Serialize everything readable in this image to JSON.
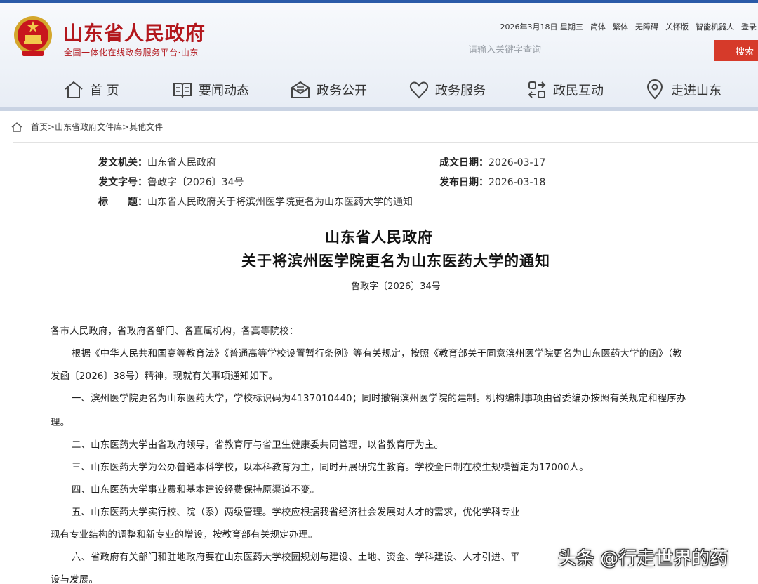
{
  "header": {
    "site_title": "山东省人民政府",
    "site_subtitle": "全国一体化在线政务服务平台·山东",
    "top_links": {
      "date": "2026年3月18日 星期三",
      "simplified": "简体",
      "traditional": "繁体",
      "accessible": "无障碍",
      "elderly": "关怀版",
      "robot": "智能机器人",
      "login": "登录"
    },
    "search": {
      "placeholder": "请输入关键字查询",
      "button": "搜索"
    },
    "nav": [
      {
        "label": "首 页",
        "icon": "home-icon"
      },
      {
        "label": "要闻动态",
        "icon": "book-icon"
      },
      {
        "label": "政务公开",
        "icon": "mail-icon"
      },
      {
        "label": "政务服务",
        "icon": "heart-icon"
      },
      {
        "label": "政民互动",
        "icon": "interaction-icon"
      },
      {
        "label": "走进山东",
        "icon": "location-icon"
      }
    ],
    "colors": {
      "brand_red": "#b3171d",
      "accent_blue": "#2a5aa8",
      "search_red": "#d63a2a"
    }
  },
  "breadcrumb": {
    "home": "首页",
    "library": "山东省政府文件库",
    "current": "其他文件",
    "separator": ">"
  },
  "meta": {
    "issuer_label": "发文机关：",
    "issuer": "山东省人民政府",
    "number_label": "发文字号：",
    "number": "鲁政字〔2026〕34号",
    "title_label": "标　　题：",
    "title": "山东省人民政府关于将滨州医学院更名为山东医药大学的通知",
    "written_label": "成文日期：",
    "written": "2026-03-17",
    "published_label": "发布日期：",
    "published": "2026-03-18"
  },
  "document": {
    "title_line1": "山东省人民政府",
    "title_line2": "关于将滨州医学院更名为山东医药大学的通知",
    "number": "鲁政字〔2026〕34号",
    "paragraphs": [
      "各市人民政府，省政府各部门、各直属机构，各高等院校：",
      "根据《中华人民共和国高等教育法》《普通高等学校设置暂行条例》等有关规定，按照《教育部关于同意滨州医学院更名为山东医药大学的函》（教",
      "发函〔2026〕38号）精神，现就有关事项通知如下。",
      "一、滨州医学院更名为山东医药大学，学校标识码为4137010440；同时撤销滨州医学院的建制。机构编制事项由省委编办按照有关规定和程序办",
      "理。",
      "二、山东医药大学由省政府领导，省教育厅与省卫生健康委共同管理，以省教育厅为主。",
      "三、山东医药大学为公办普通本科学校，以本科教育为主，同时开展研究生教育。学校全日制在校生规模暂定为17000人。",
      "四、山东医药大学事业费和基本建设经费保持原渠道不变。",
      "五、山东医药大学实行校、院（系）两级管理。学校应根据我省经济社会发展对人才的需求，优化学科专业",
      "现有专业结构的调整和新专业的增设，按教育部有关规定办理。",
      "六、省政府有关部门和驻地政府要在山东医药大学校园规划与建设、土地、资金、学科建设、人才引进、平",
      "设与发展。"
    ]
  },
  "watermark": "头条 @行走世界的药"
}
